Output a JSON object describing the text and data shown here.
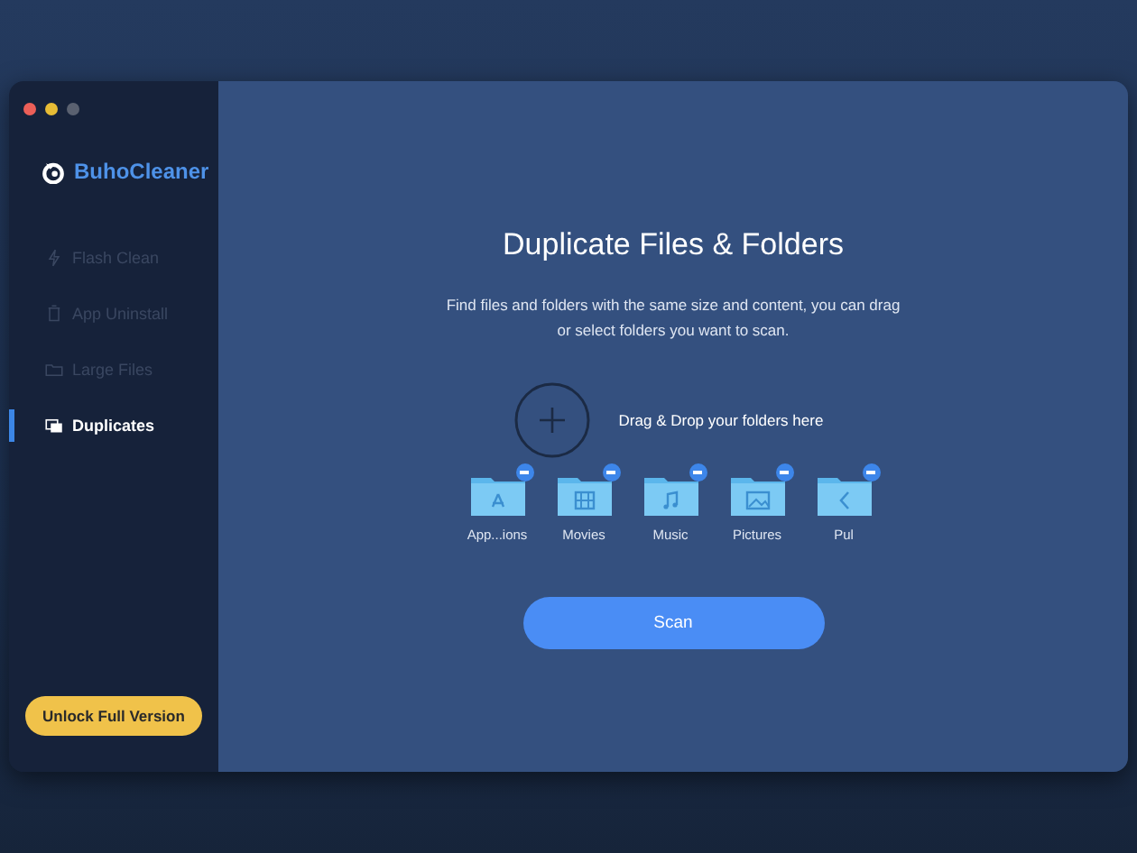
{
  "sidebar": {
    "app_name": "BuhoCleaner",
    "items": [
      {
        "label": "Flash Clean",
        "kind": "bolt",
        "selected": false
      },
      {
        "label": "App Uninstall",
        "kind": "trash",
        "selected": false
      },
      {
        "label": "Large Files",
        "kind": "folder",
        "selected": false
      },
      {
        "label": "Duplicates",
        "kind": "copies",
        "selected": true
      }
    ],
    "unlock_button": "Unlock Full Version"
  },
  "main": {
    "title": "Duplicate Files & Folders",
    "description": "Find files and folders with the same size and content, you can drag or select folders you want to scan.",
    "drop_hint": "Drag & Drop your folders here",
    "folders": [
      {
        "label": "App...ions",
        "kind": "apps"
      },
      {
        "label": "Movies",
        "kind": "film"
      },
      {
        "label": "Music",
        "kind": "music"
      },
      {
        "label": "Pictures",
        "kind": "image"
      },
      {
        "label": "Pul",
        "kind": "public"
      }
    ],
    "scan_button": "Scan"
  }
}
